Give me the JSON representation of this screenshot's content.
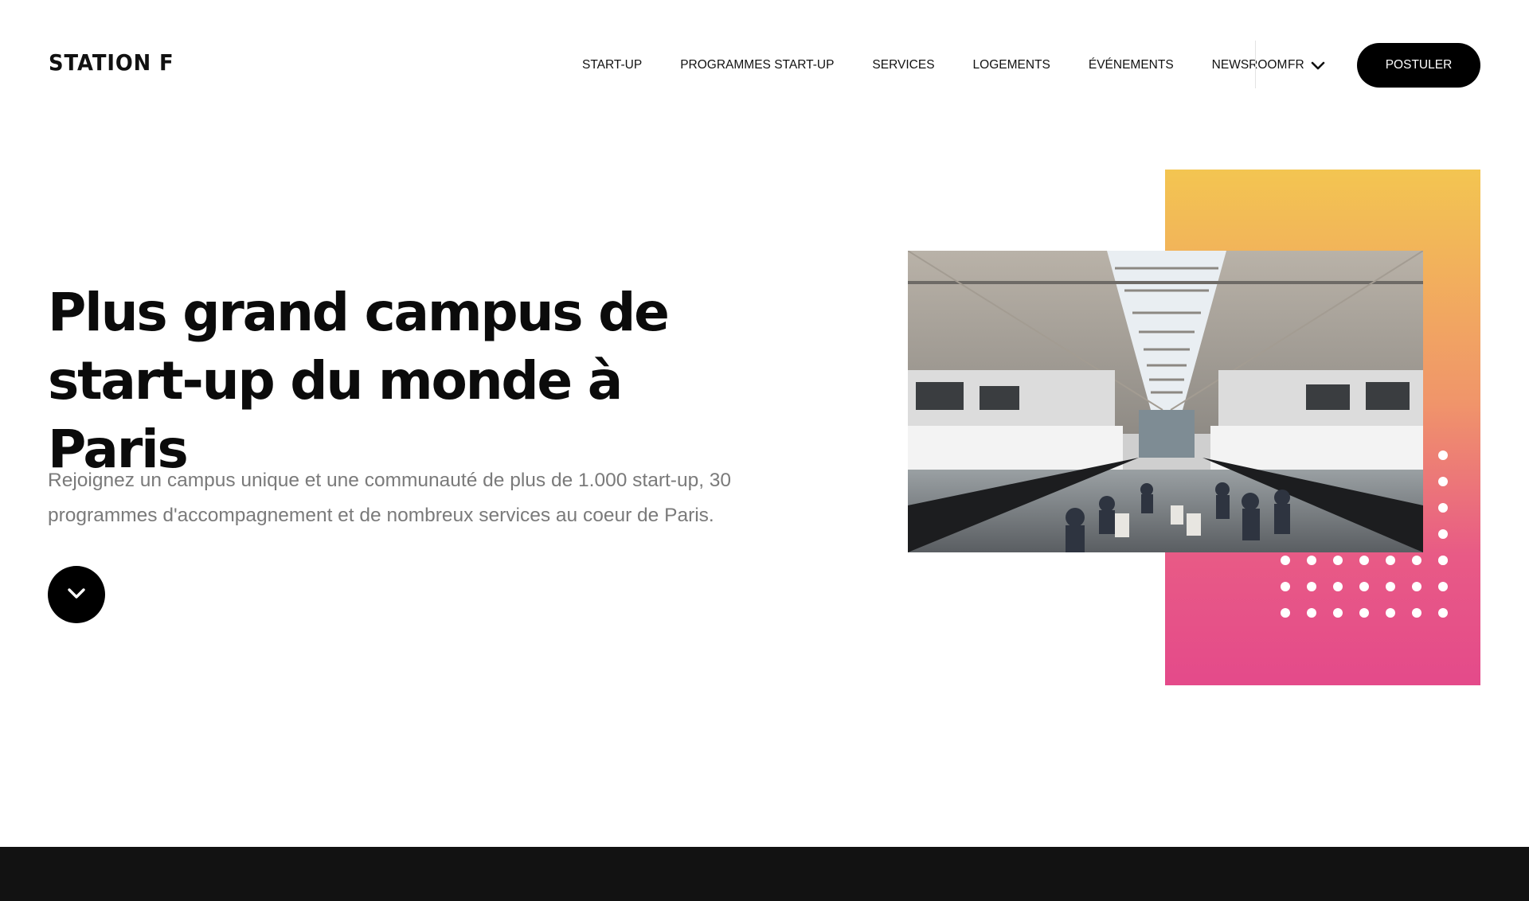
{
  "header": {
    "logo": "STATION F",
    "nav": [
      "START-UP",
      "PROGRAMMES START-UP",
      "SERVICES",
      "LOGEMENTS",
      "ÉVÉNEMENTS",
      "NEWSROOM"
    ],
    "language": "FR",
    "language_icon": "chevron-down-icon",
    "cta": "POSTULER"
  },
  "hero": {
    "title": "Plus grand campus de start-up du monde à Paris",
    "subtitle": "Rejoignez un campus unique et une communauté de plus de 1.000 start-up, 30 programmes d'accompagnement et de nombreux services au coeur de Paris.",
    "scroll_icon": "chevron-down-icon",
    "photo_icon": "campus-interior-photo"
  },
  "colors": {
    "accent_black": "#000000",
    "gradient_top": "#f3c551",
    "gradient_bottom": "#e44a8a",
    "subtitle_gray": "#7a7a7a",
    "dark_band": "#121212"
  }
}
